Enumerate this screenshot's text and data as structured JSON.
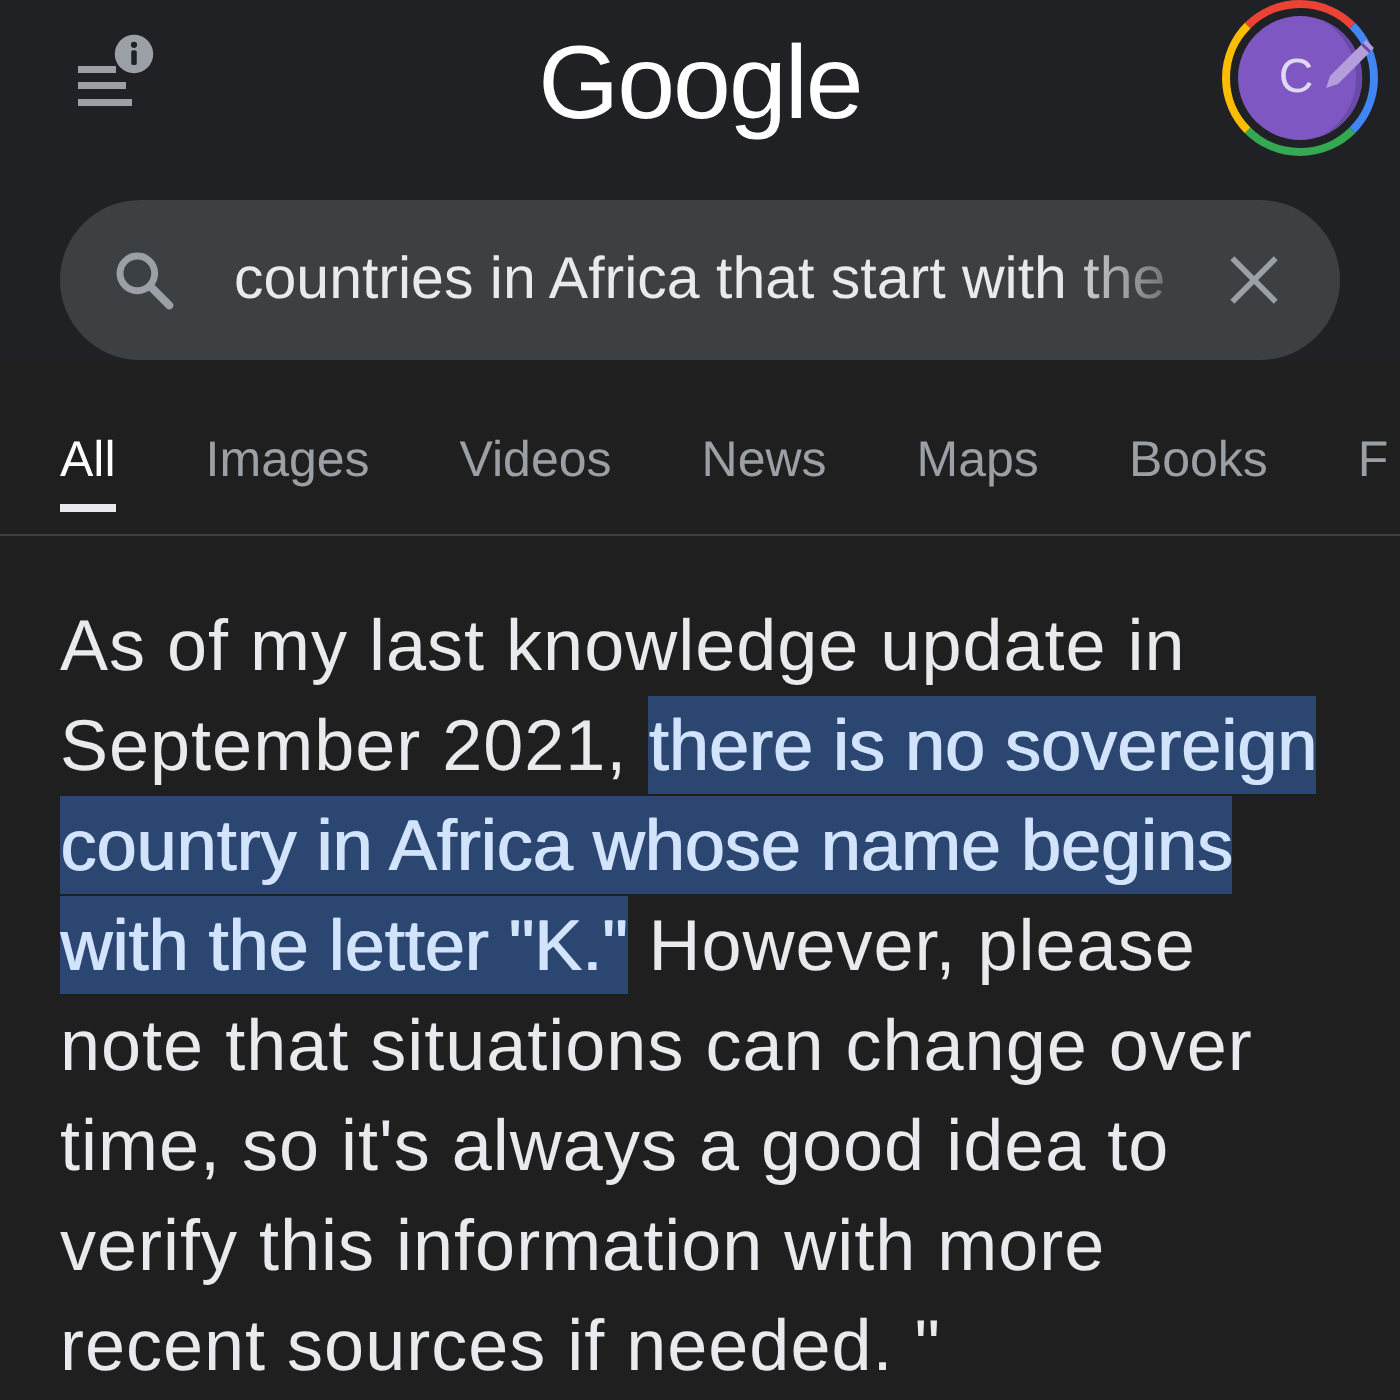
{
  "header": {
    "logo": "Google",
    "avatar": {
      "initial": "C"
    }
  },
  "search": {
    "value": "countries in Africa that start with the"
  },
  "tabs": [
    {
      "label": "All",
      "selected": true
    },
    {
      "label": "Images",
      "selected": false
    },
    {
      "label": "Videos",
      "selected": false
    },
    {
      "label": "News",
      "selected": false
    },
    {
      "label": "Maps",
      "selected": false
    },
    {
      "label": "Books",
      "selected": false
    },
    {
      "label": "F",
      "selected": false
    }
  ],
  "answer": {
    "segments": [
      {
        "text": "As of my last knowledge update in September 2021, ",
        "highlighted": false
      },
      {
        "text": "there is no sovereign country in Africa whose name begins with the letter \"K.\"",
        "highlighted": true
      },
      {
        "text": " However, please note that situations can change over time, so it's always a good idea to verify this information with more recent sources if needed. \"",
        "highlighted": false
      }
    ]
  }
}
